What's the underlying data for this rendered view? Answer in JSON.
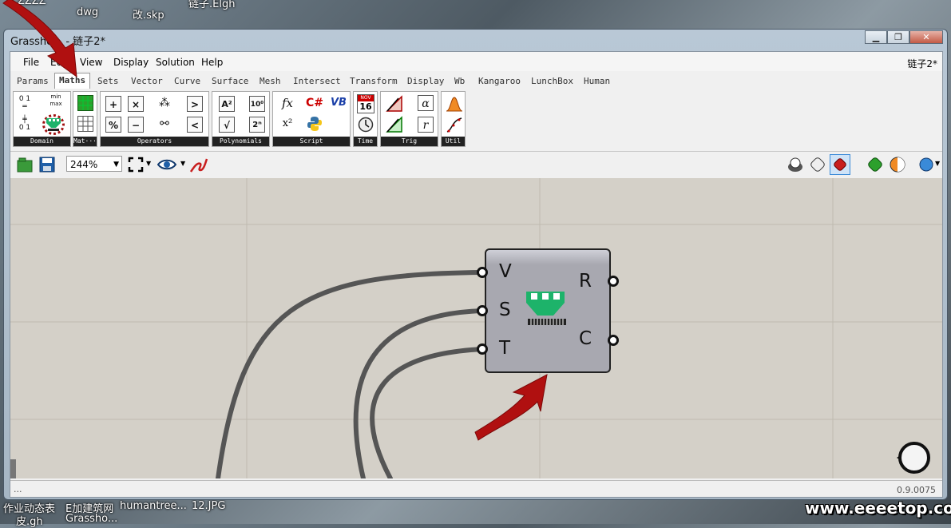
{
  "desktop": {
    "top_labels": [
      "ZZZZ",
      "dwg",
      "改.skp",
      "链子.Elgh"
    ],
    "bottom_labels": [
      "作业动态表",
      "皮.gh",
      "E加建筑网",
      "Grassho...",
      "humantree...",
      "12.JPG"
    ]
  },
  "watermark": "www.eeeetop.com",
  "window": {
    "title": "Grassho... - 链子2*",
    "controls": [
      "▁",
      "❐",
      "✕"
    ]
  },
  "menu": {
    "items": [
      "File",
      "Edit",
      "View",
      "Display",
      "Solution",
      "Help"
    ],
    "document": "链子2*"
  },
  "tabs": [
    "Params",
    "Maths",
    "Sets",
    "Vector",
    "Curve",
    "Surface",
    "Mesh",
    "Intersect",
    "Transform",
    "Display",
    "Wb",
    "Kangaroo",
    "LunchBox",
    "Human"
  ],
  "active_tab": "Maths",
  "ribbon_groups": [
    {
      "name": "Domain"
    },
    {
      "name": "Mat···"
    },
    {
      "name": "Operators"
    },
    {
      "name": "Polynomials"
    },
    {
      "name": "Script"
    },
    {
      "name": "Time"
    },
    {
      "name": "Trig"
    },
    {
      "name": "Util"
    }
  ],
  "ribbon_icon_text": {
    "minmax": "min max",
    "plus": "+",
    "times": "×",
    "divide": "%",
    "minus": "−",
    "gt": ">",
    "lt": "<",
    "a2": "A²",
    "sqrt": "√",
    "ten": "10⁰",
    "two": "2ⁿ",
    "fx": "fx",
    "x2": "x²",
    "csharp": "C#",
    "vb": "VB",
    "cal_month": "NOV",
    "cal_day": "16",
    "alpha": "α",
    "r": "r"
  },
  "toolbar": {
    "zoom": "244%"
  },
  "component": {
    "inputs": [
      "V",
      "S",
      "T"
    ],
    "outputs": [
      "R",
      "C"
    ]
  },
  "status": {
    "left": "...",
    "version": "0.9.0075"
  },
  "colors": {
    "canvas": "#d4d0c8",
    "wire": "#555555",
    "component": "#a8a8b0",
    "arrow": "#b01010",
    "icon_green": "#1db36a"
  }
}
